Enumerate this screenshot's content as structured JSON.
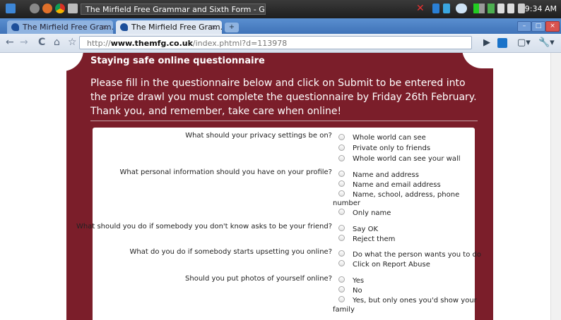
{
  "taskbar": {
    "window_title": "The Mirfield Free Grammar and Sixth Form - Google Chrome",
    "clock": "9:34 AM"
  },
  "tabs": [
    {
      "label": "The Mirfield Free Gram...",
      "active": false
    },
    {
      "label": "The Mirfield Free Gram...",
      "active": true
    }
  ],
  "address_bar": {
    "prefix": "http://",
    "domain": "www.themfg.co.uk",
    "path": "/index.phtml?d=113978"
  },
  "page": {
    "heading": "Staying safe online questionnaire",
    "intro": "Please fill in the questionnaire below and click on Submit to be entered into the prize drawl you must complete the questionnaire by Friday 26th February. Thank you, and remember, take care when online!",
    "questions": [
      {
        "text": "What should your privacy settings be on?",
        "options": [
          "Whole world can see",
          "Private only to friends",
          "Whole world can see your wall"
        ]
      },
      {
        "text": "What personal information should you have on your profile?",
        "options": [
          "Name and address",
          "Name and email address",
          "Name, school, address, phone",
          "Only name"
        ],
        "wrap": "number"
      },
      {
        "text": "What should you do if somebody you don't know asks to be your friend?",
        "options": [
          "Say OK",
          "Reject them"
        ]
      },
      {
        "text": "What do you do if somebody starts upsetting you online?",
        "options": [
          "Do what the person wants you to do",
          "Click on Report Abuse"
        ]
      },
      {
        "text": "Should you put photos of yourself online?",
        "options": [
          "Yes",
          "No",
          "Yes, but only ones you'd show your"
        ],
        "wrap": "family"
      }
    ]
  },
  "colors": {
    "card_background": "#7b1e2a",
    "tab_strip": "#4a7fc4"
  }
}
